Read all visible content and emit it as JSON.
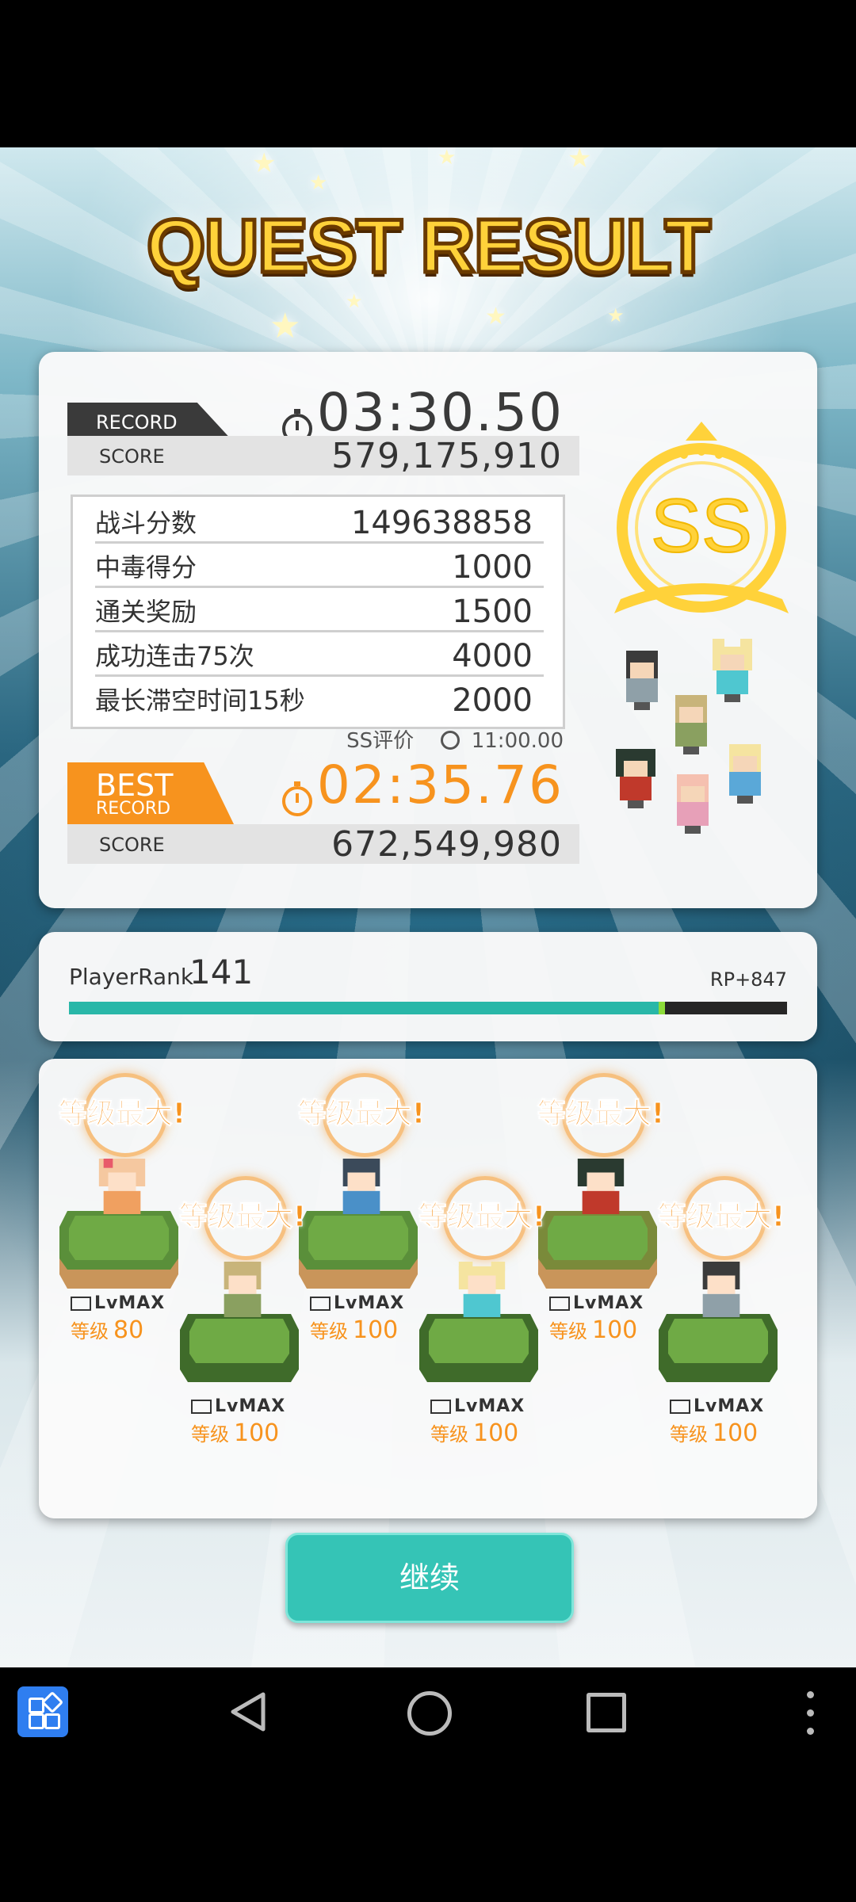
{
  "title": "QUEST RESULT",
  "record": {
    "tag": "RECORD",
    "time": "03:30.50",
    "score_label": "SCORE",
    "score": "579,175,910",
    "breakdown": [
      {
        "label": "战斗分数",
        "value": "149638858"
      },
      {
        "label": "中毒得分",
        "value": "1000"
      },
      {
        "label": "通关奖励",
        "value": "1500"
      },
      {
        "label": "成功连击75次",
        "value": "4000"
      },
      {
        "label": "最长滞空时间15秒",
        "value": "2000"
      }
    ],
    "ss_label": "SS评价",
    "ss_time": "11:00.00",
    "grade": "SS"
  },
  "best": {
    "tag_big": "BEST",
    "tag_small": "RECORD",
    "time": "02:35.76",
    "score_label": "SCORE",
    "score": "672,549,980"
  },
  "player": {
    "rank_label": "PlayerRank",
    "rank": "141",
    "rp": "RP+847",
    "progress": 0.83
  },
  "characters": [
    {
      "max_label": "等级最大!",
      "lvmax": "LvMAX",
      "level_label": "等级",
      "level": "80"
    },
    {
      "max_label": "等级最大!",
      "lvmax": "LvMAX",
      "level_label": "等级",
      "level": "100"
    },
    {
      "max_label": "等级最大!",
      "lvmax": "LvMAX",
      "level_label": "等级",
      "level": "100"
    },
    {
      "max_label": "等级最大!",
      "lvmax": "LvMAX",
      "level_label": "等级",
      "level": "100"
    },
    {
      "max_label": "等级最大!",
      "lvmax": "LvMAX",
      "level_label": "等级",
      "level": "100"
    },
    {
      "max_label": "等级最大!",
      "lvmax": "LvMAX",
      "level_label": "等级",
      "level": "100"
    }
  ],
  "continue_label": "继续",
  "colors": {
    "accent": "#f7931e",
    "teal": "#35c4b6",
    "gold": "#ffd23a"
  },
  "nav_icons": [
    "app-switcher-icon",
    "back-icon",
    "home-icon",
    "recents-icon",
    "more-icon"
  ]
}
